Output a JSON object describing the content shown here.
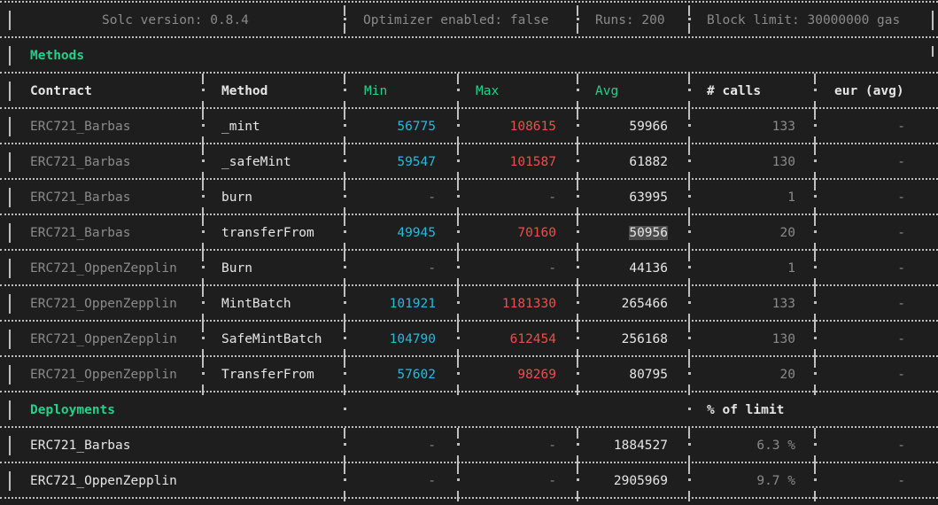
{
  "header": {
    "solc": "Solc version: 0.8.4",
    "optimizer": "Optimizer enabled: false",
    "runs": "Runs: 200",
    "block_limit": "Block limit: 30000000 gas"
  },
  "methods_section": {
    "title": "Methods",
    "columns": {
      "contract": "Contract",
      "method": "Method",
      "min": "Min",
      "max": "Max",
      "avg": "Avg",
      "calls": "# calls",
      "eur": "eur (avg)"
    },
    "rows": [
      {
        "contract": "ERC721_Barbas",
        "method": "_mint",
        "min": "56775",
        "max": "108615",
        "avg": "59966",
        "calls": "133",
        "eur": "-"
      },
      {
        "contract": "ERC721_Barbas",
        "method": "_safeMint",
        "min": "59547",
        "max": "101587",
        "avg": "61882",
        "calls": "130",
        "eur": "-"
      },
      {
        "contract": "ERC721_Barbas",
        "method": "burn",
        "min": "-",
        "max": "-",
        "avg": "63995",
        "calls": "1",
        "eur": "-"
      },
      {
        "contract": "ERC721_Barbas",
        "method": "transferFrom",
        "min": "49945",
        "max": "70160",
        "avg": "50956",
        "calls": "20",
        "eur": "-"
      },
      {
        "contract": "ERC721_OppenZepplin",
        "method": "Burn",
        "min": "-",
        "max": "-",
        "avg": "44136",
        "calls": "1",
        "eur": "-"
      },
      {
        "contract": "ERC721_OppenZepplin",
        "method": "MintBatch",
        "min": "101921",
        "max": "1181330",
        "avg": "265466",
        "calls": "133",
        "eur": "-"
      },
      {
        "contract": "ERC721_OppenZepplin",
        "method": "SafeMintBatch",
        "min": "104790",
        "max": "612454",
        "avg": "256168",
        "calls": "130",
        "eur": "-"
      },
      {
        "contract": "ERC721_OppenZepplin",
        "method": "TransferFrom",
        "min": "57602",
        "max": "98269",
        "avg": "80795",
        "calls": "20",
        "eur": "-"
      }
    ]
  },
  "deployments_section": {
    "title": "Deployments",
    "limit_header": "% of limit",
    "rows": [
      {
        "contract": "ERC721_Barbas",
        "min": "-",
        "max": "-",
        "avg": "1884527",
        "pct": "6.3 %",
        "eur": "-"
      },
      {
        "contract": "ERC721_OppenZepplin",
        "min": "-",
        "max": "-",
        "avg": "2905969",
        "pct": "9.7 %",
        "eur": "-"
      }
    ]
  },
  "colors": {
    "background": "#1e1e1e",
    "green": "#23d18b",
    "blue": "#29b8db",
    "red": "#f14c4c",
    "dim": "#8a8a8a"
  }
}
